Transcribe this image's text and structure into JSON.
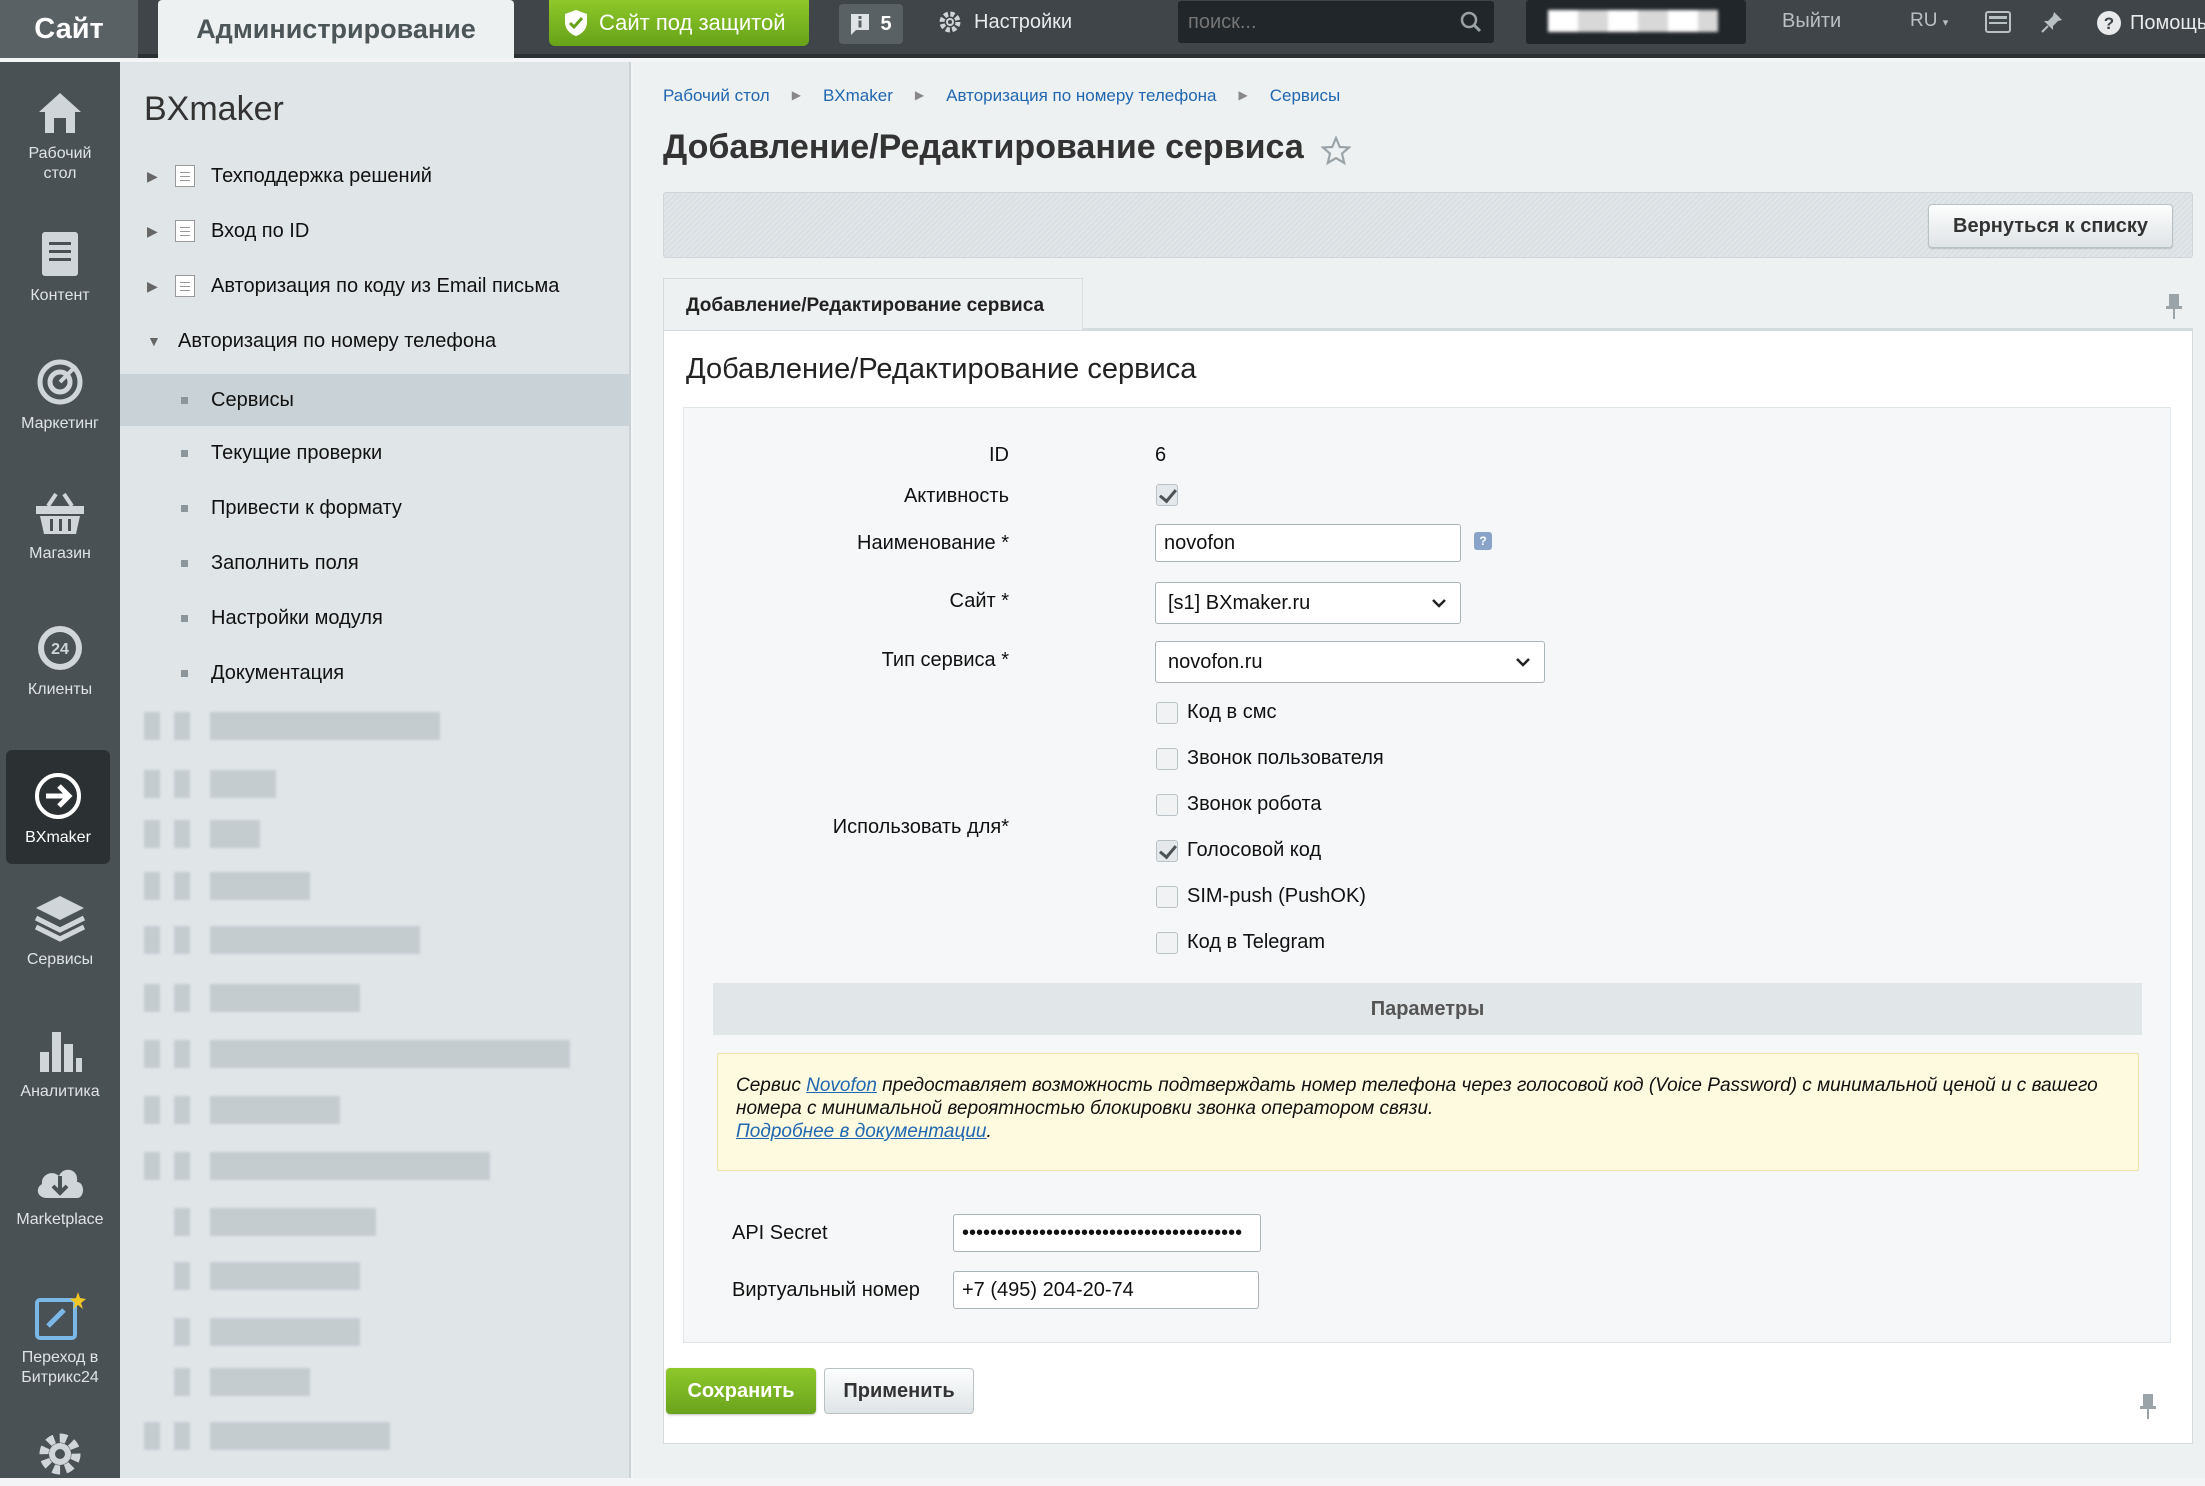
{
  "topbar": {
    "site_label": "Сайт",
    "admin_label": "Администрирование",
    "protected_label": "Сайт под защитой",
    "notifications_count": "5",
    "settings_label": "Настройки",
    "search_placeholder": "поиск...",
    "logout_label": "Выйти",
    "lang_label": "RU",
    "help_label": "Помощь",
    "accent_green": "#7cb41f"
  },
  "rail": {
    "items": [
      {
        "label": "Рабочий стол",
        "icon": "home-icon"
      },
      {
        "label": "Контент",
        "icon": "content-icon"
      },
      {
        "label": "Маркетинг",
        "icon": "target-icon"
      },
      {
        "label": "Магазин",
        "icon": "basket-icon"
      },
      {
        "label": "Клиенты",
        "icon": "clients-24-icon"
      },
      {
        "label": "BXmaker",
        "icon": "arrow-circle-icon"
      },
      {
        "label": "Сервисы",
        "icon": "layers-icon"
      },
      {
        "label": "Аналитика",
        "icon": "bar-chart-icon"
      },
      {
        "label": "Marketplace",
        "icon": "cloud-download-icon"
      },
      {
        "label": "Переход в Битрикс24",
        "icon": "bitrix24-transfer-icon"
      },
      {
        "label": "",
        "icon": "gear-icon"
      }
    ]
  },
  "menu": {
    "title": "BXmaker",
    "items": [
      {
        "label": "Техподдержка решений"
      },
      {
        "label": "Вход по ID"
      },
      {
        "label": "Авторизация по коду из Email письма"
      },
      {
        "label": "Авторизация по номеру телефона"
      },
      {
        "label": "Сервисы"
      },
      {
        "label": "Текущие проверки"
      },
      {
        "label": "Привести к формату"
      },
      {
        "label": "Заполнить поля"
      },
      {
        "label": "Настройки модуля"
      },
      {
        "label": "Документация"
      }
    ]
  },
  "breadcrumbs": [
    "Рабочий стол",
    "BXmaker",
    "Авторизация по номеру телефона",
    "Сервисы"
  ],
  "page": {
    "title": "Добавление/Редактирование сервиса",
    "back_button": "Вернуться к списку",
    "tab_label": "Добавление/Редактирование сервиса",
    "panel_title": "Добавление/Редактирование сервиса"
  },
  "form": {
    "id_label": "ID",
    "id_value": "6",
    "active_label": "Активность",
    "active_checked": true,
    "name_label": "Наименование *",
    "name_value": "novofon",
    "site_label": "Сайт *",
    "site_value": "[s1] BXmaker.ru",
    "type_label": "Тип сервиса *",
    "type_value": "novofon.ru",
    "use_for_label": "Использовать для*",
    "use_for": [
      {
        "label": "Код в смс",
        "checked": false
      },
      {
        "label": "Звонок пользователя",
        "checked": false
      },
      {
        "label": "Звонок робота",
        "checked": false
      },
      {
        "label": "Голосовой код",
        "checked": true
      },
      {
        "label": "SIM-push (PushOK)",
        "checked": false
      },
      {
        "label": "Код в Telegram",
        "checked": false
      }
    ],
    "params_header": "Параметры",
    "note_prefix": "Сервис ",
    "note_link": "Novofon",
    "note_text": " предоставляет возможность подтверждать номер телефона через голосовой код (Voice Password) с минимальной ценой и с вашего номера с минимальной вероятностью блокировки звонка оператором связи.",
    "note_doc_link": "Подробнее в документации",
    "api_secret_label": "API Secret",
    "api_secret_value": "••••••••••••••••••••••••••••••••••••••••",
    "virtual_number_label": "Виртуальный номер",
    "virtual_number_value": "+7 (495) 204-20-74"
  },
  "footer": {
    "save_label": "Сохранить",
    "apply_label": "Применить"
  }
}
